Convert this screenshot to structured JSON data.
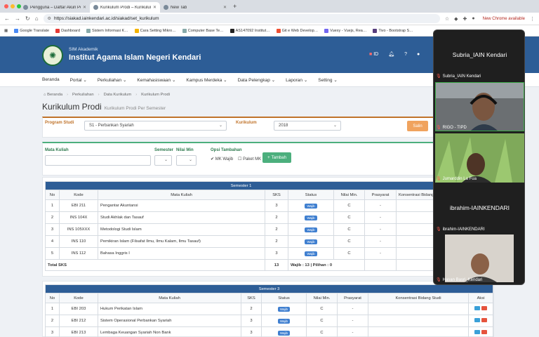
{
  "browser": {
    "tabs": [
      {
        "title": "Pengguna – Daftar Akun Perso…",
        "active": false
      },
      {
        "title": "Kurikulum Prodi – Kurikulum P…",
        "active": true
      },
      {
        "title": "New Tab",
        "active": false
      }
    ],
    "url": "https://siakad.iainkendari.ac.id/siakad/set_kurikulum",
    "chrome_notice": "New Chrome available",
    "bookmarks": [
      "Google Translate",
      "Dashboard",
      "Sistem Informasi K…",
      "Cara Setting Mikro…",
      "Computer Base Te…",
      "AS147092 Institut…",
      "Git e Web Develop…",
      "Vuexy - Vuejs, Rea…",
      "Tivo - Bootstrap S…"
    ]
  },
  "header": {
    "subtitle": "SIM Akademik",
    "title": "Institut Agama Islam Negeri Kendari",
    "lang": "ID"
  },
  "menu": [
    "Beranda",
    "Portal",
    "Perkuliahan",
    "Kemahasiswaan",
    "Kampus Merdeka",
    "Data Pelengkap",
    "Laporan",
    "Setting"
  ],
  "breadcrumb": [
    "Beranda",
    "Perkuliahan",
    "Data Kurikulum",
    "Kurikulum Prodi"
  ],
  "page": {
    "title": "Kurikulum Prodi",
    "subtitle": "Kurikulum Prodi Per Semester"
  },
  "filter": {
    "prodi_label": "Program Studi",
    "prodi_value": "S1 - Perbankan Syariah",
    "kurikulum_label": "Kurikulum",
    "kurikulum_value": "2018",
    "button_label": "Salin"
  },
  "addform": {
    "mk_label": "Mata Kuliah",
    "semester_label": "Semester",
    "nilai_label": "Nilai Min",
    "opsi_label": "Opsi Tambahan",
    "opt_wajib": "MK Wajib",
    "opt_paket": "Paket MK",
    "add_label": "Tambah"
  },
  "columns": [
    "No",
    "Kode",
    "Mata Kuliah",
    "SKS",
    "Status",
    "Nilai Min.",
    "Prasyarat",
    "Konsentrasi Bidang Studi",
    "Aksi"
  ],
  "semester1": {
    "title": "Semester 1",
    "rows": [
      {
        "no": "1",
        "kode": "EBI 211",
        "mk": "Pengantar Akuntansi",
        "sks": "3",
        "status": "Wajib",
        "nilai": "C",
        "pras": "-"
      },
      {
        "no": "2",
        "kode": "INS 104X",
        "mk": "Studi Akhlak dan Tasauf",
        "sks": "2",
        "status": "Wajib",
        "nilai": "C",
        "pras": "-"
      },
      {
        "no": "3",
        "kode": "INS 105XXX",
        "mk": "Metodologi Studi Islam",
        "sks": "2",
        "status": "Wajib",
        "nilai": "C",
        "pras": "-"
      },
      {
        "no": "4",
        "kode": "INS 110",
        "mk": "Pemikiran Islam (Filsafat Ilmu, Ilmu Kalam, Ilmu Tasauf)",
        "sks": "2",
        "status": "Wajib",
        "nilai": "C",
        "pras": "-"
      },
      {
        "no": "5",
        "kode": "INS 112",
        "mk": "Bahasa Inggris I",
        "sks": "3",
        "status": "Wajib",
        "nilai": "C",
        "pras": "-"
      }
    ],
    "total_label": "Total SKS",
    "total_sks": "13",
    "total_detail": "Wajib : 13 | Pilihan : 0"
  },
  "semester3": {
    "title": "Semester 3",
    "rows": [
      {
        "no": "1",
        "kode": "EBI 203",
        "mk": "Hukum Perikatan Islam",
        "sks": "2",
        "status": "Wajib",
        "nilai": "C",
        "pras": "-"
      },
      {
        "no": "2",
        "kode": "EBI 212",
        "mk": "Sistem Operasional Perbankan Syariah",
        "sks": "3",
        "status": "Wajib",
        "nilai": "C",
        "pras": "-"
      },
      {
        "no": "3",
        "kode": "EBI 213",
        "mk": "Lembaga Keuangan Syariah Non Bank",
        "sks": "3",
        "status": "Wajib",
        "nilai": "C",
        "pras": "-"
      }
    ]
  },
  "meeting": {
    "participants": [
      {
        "name": "Subria_IAIN Kendari",
        "type": "name"
      },
      {
        "name": "RIGO - TIPD",
        "type": "video"
      },
      {
        "name": "Jumarddin La Fua",
        "type": "video"
      },
      {
        "name": "ibrahim-IAINKENDARI",
        "type": "name"
      },
      {
        "name": "Hasan Basri_Kendari",
        "type": "video"
      }
    ]
  },
  "colors": {
    "primary": "#2d5d96",
    "accent": "#c0732a",
    "salin": "#f0a35e",
    "tambah": "#4caf7d",
    "badge": "#3f7fd0"
  }
}
